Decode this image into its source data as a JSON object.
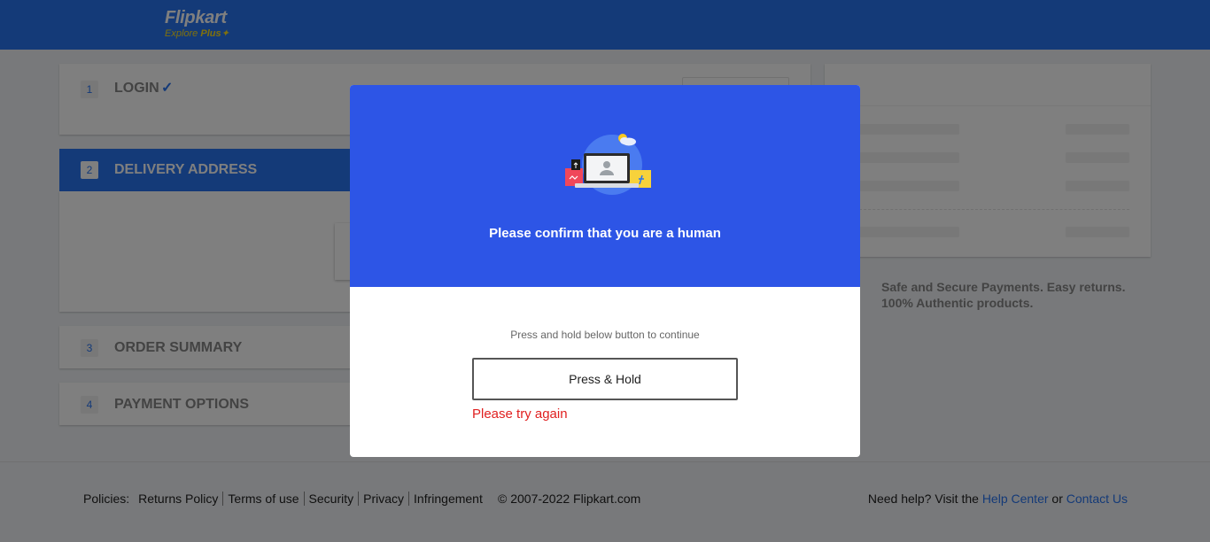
{
  "header": {
    "logo_main": "Flipkart",
    "logo_sub": "Explore",
    "logo_plus": "Plus",
    "colors": {
      "primary": "#2874f0",
      "accent": "#ffe11b"
    }
  },
  "steps": [
    {
      "num": "1",
      "label": "LOGIN",
      "completed": true
    },
    {
      "num": "2",
      "label": "DELIVERY ADDRESS",
      "active": true
    },
    {
      "num": "3",
      "label": "ORDER SUMMARY"
    },
    {
      "num": "4",
      "label": "PAYMENT OPTIONS"
    }
  ],
  "safe_text": "Safe and Secure Payments. Easy returns. 100% Authentic products.",
  "footer": {
    "policies_label": "Policies:",
    "policies": [
      "Returns Policy",
      "Terms of use",
      "Security",
      "Privacy",
      "Infringement"
    ],
    "copyright": "© 2007-2022 Flipkart.com",
    "help_prefix": "Need help? Visit the",
    "help_center": "Help Center",
    "or": "or",
    "contact_us": "Contact Us"
  },
  "modal": {
    "heading": "Please confirm that you are a human",
    "hint": "Press and hold below button to continue",
    "button_label": "Press & Hold",
    "error": "Please try again",
    "colors": {
      "top_bg": "#2d55e6",
      "error": "#e02020"
    }
  }
}
